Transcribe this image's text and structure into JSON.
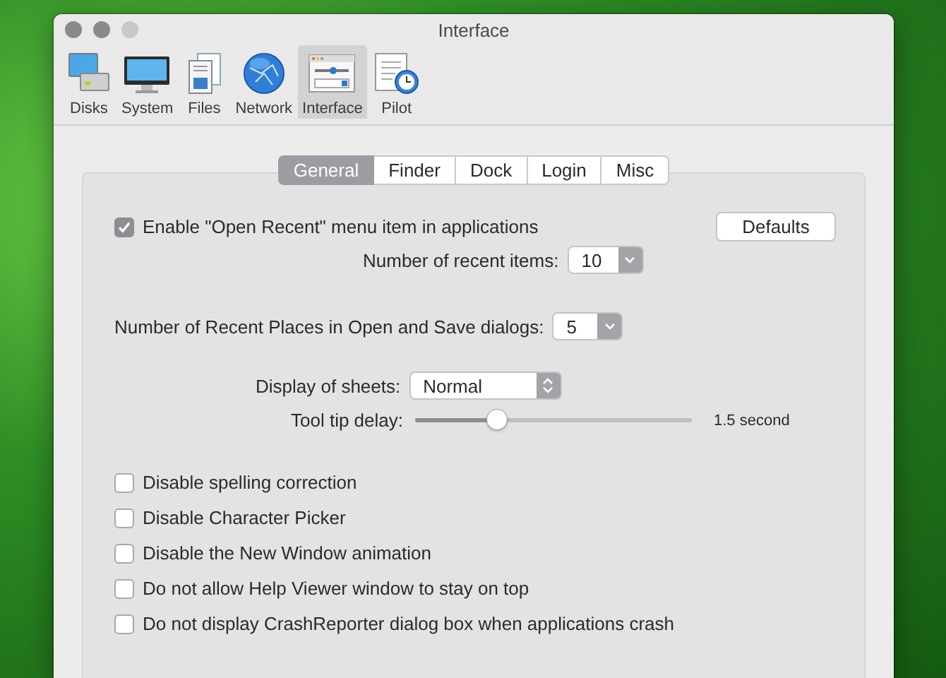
{
  "window": {
    "title": "Interface"
  },
  "toolbar": [
    {
      "kind": "disks",
      "label": "Disks",
      "selected": false
    },
    {
      "kind": "system",
      "label": "System",
      "selected": false
    },
    {
      "kind": "files",
      "label": "Files",
      "selected": false
    },
    {
      "kind": "network",
      "label": "Network",
      "selected": false
    },
    {
      "kind": "interface",
      "label": "Interface",
      "selected": true
    },
    {
      "kind": "pilot",
      "label": "Pilot",
      "selected": false
    }
  ],
  "tabs": [
    {
      "label": "General",
      "selected": true
    },
    {
      "label": "Finder",
      "selected": false
    },
    {
      "label": "Dock",
      "selected": false
    },
    {
      "label": "Login",
      "selected": false
    },
    {
      "label": "Misc",
      "selected": false
    }
  ],
  "open_recent": {
    "label": "Enable \"Open Recent\" menu item in applications",
    "checked": true
  },
  "defaults_button": "Defaults",
  "recent_items": {
    "label": "Number of recent items:",
    "value": "10"
  },
  "recent_places": {
    "label": "Number of Recent Places in Open and Save dialogs:",
    "value": "5"
  },
  "sheets": {
    "label": "Display of sheets:",
    "value": "Normal"
  },
  "tooltip_delay": {
    "label": "Tool tip delay:",
    "level": 0.3,
    "reading": "1.5 second"
  },
  "options": [
    {
      "label": "Disable spelling correction",
      "checked": false
    },
    {
      "label": "Disable Character Picker",
      "checked": false
    },
    {
      "label": "Disable the New Window animation",
      "checked": false
    },
    {
      "label": "Do not allow Help Viewer window to stay on top",
      "checked": false
    },
    {
      "label": "Do not display CrashReporter dialog box when applications crash",
      "checked": false
    }
  ]
}
